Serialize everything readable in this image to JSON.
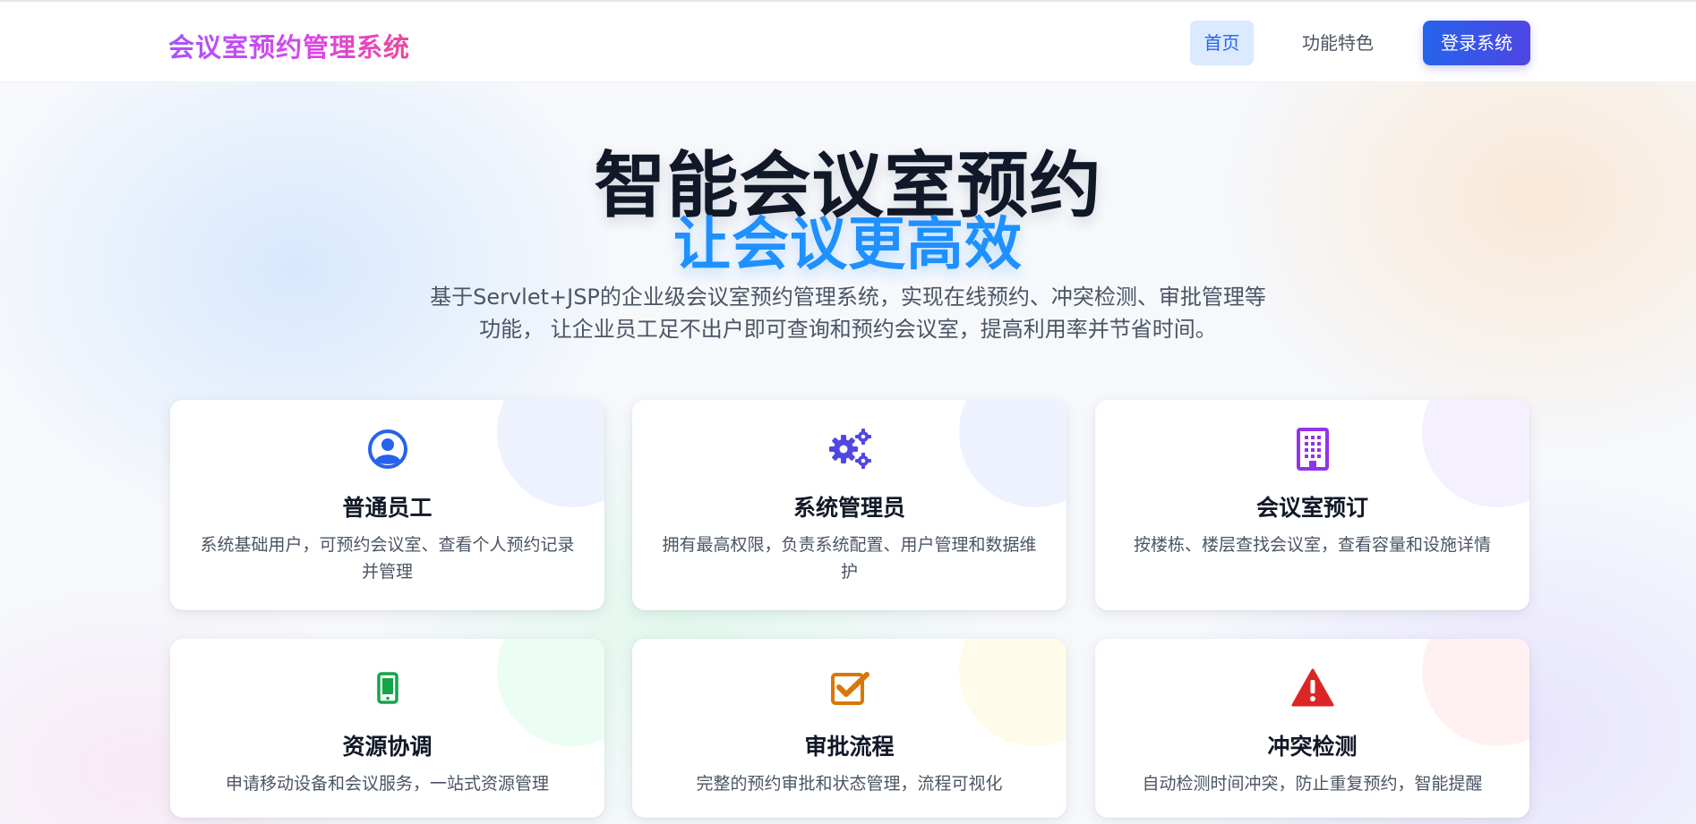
{
  "header": {
    "brand": "会议室预约管理系统",
    "nav_home": "首页",
    "nav_features": "功能特色",
    "login_button": "登录系统"
  },
  "hero": {
    "title": "智能会议室预约",
    "subtitle": "让会议更高效",
    "description": "基于Servlet+JSP的企业级会议室预约管理系统，实现在线预约、冲突检测、审批管理等功能， 让企业员工足不出户即可查询和预约会议室，提高利用率并节省时间。"
  },
  "features": [
    {
      "icon": "user-circle-icon",
      "title": "普通员工",
      "description": "系统基础用户，可预约会议室、查看个人预约记录并管理",
      "icon_color": "#2563eb",
      "deco_color": "#eef2ff"
    },
    {
      "icon": "gears-icon",
      "title": "系统管理员",
      "description": "拥有最高权限，负责系统配置、用户管理和数据维护",
      "icon_color": "#4f46e5",
      "deco_color": "#eef2ff"
    },
    {
      "icon": "building-icon",
      "title": "会议室预订",
      "description": "按楼栋、楼层查找会议室，查看容量和设施详情",
      "icon_color": "#9333ea",
      "deco_color": "#f5f0ff"
    },
    {
      "icon": "mobile-phone-icon",
      "title": "资源协调",
      "description": "申请移动设备和会议服务，一站式资源管理",
      "icon_color": "#16a34a",
      "deco_color": "#ecfdf3"
    },
    {
      "icon": "check-square-icon",
      "title": "审批流程",
      "description": "完整的预约审批和状态管理，流程可视化",
      "icon_color": "#d97706",
      "deco_color": "#fefce8"
    },
    {
      "icon": "warning-triangle-icon",
      "title": "冲突检测",
      "description": "自动检测时间冲突，防止重复预约，智能提醒",
      "icon_color": "#dc2626",
      "deco_color": "#fff1f2"
    }
  ]
}
